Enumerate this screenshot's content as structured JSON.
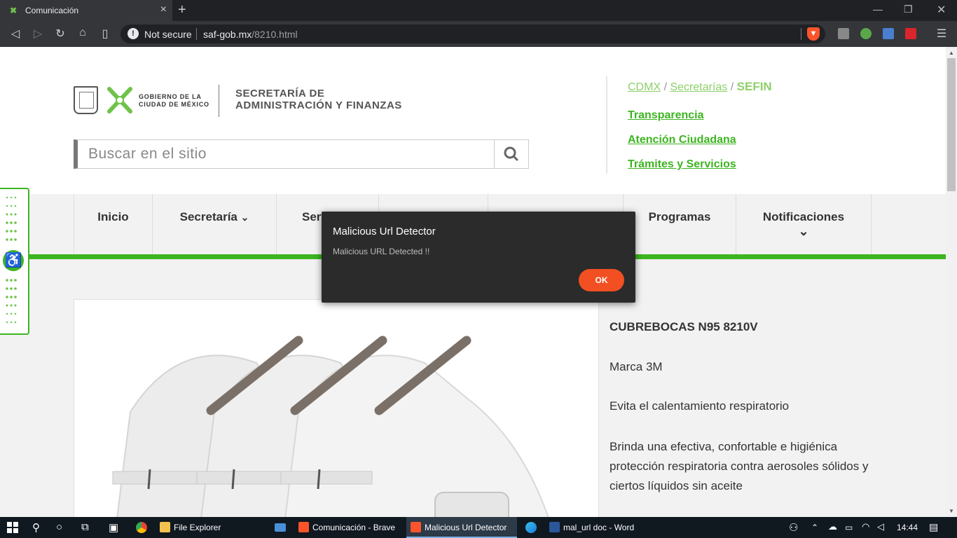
{
  "browser": {
    "tab_title": "Comunicación",
    "not_secure": "Not secure",
    "url_host": "saf-gob.mx",
    "url_path": "/8210.html"
  },
  "header": {
    "gov_line1": "GOBIERNO DE LA",
    "gov_line2": "CIUDAD DE MÉXICO",
    "secretaria_line1": "SECRETARÍA DE",
    "secretaria_line2": "ADMINISTRACIÓN Y FINANZAS",
    "search_placeholder": "Buscar en el sitio"
  },
  "breadcrumb": {
    "cdmx": "CDMX",
    "sep1": "/",
    "secretarias": "Secretarías",
    "sep2": "/",
    "current": "SEFIN"
  },
  "side_links": {
    "transparencia": "Transparencia",
    "atencion": "Atención Ciudadana",
    "tramites": "Trámites y Servicios"
  },
  "nav": {
    "inicio": "Inicio",
    "secretaria": "Secretaría",
    "servicios_partial": "Serv",
    "programas": "Programas",
    "notificaciones": "Notificaciones"
  },
  "product": {
    "title": "CUBREBOCAS N95 8210V",
    "brand": "Marca 3M",
    "line1": "Evita el calentamiento respiratorio",
    "desc": "Brinda una efectiva, confortable e higiénica protección respiratoria contra aerosoles sólidos y ciertos líquidos sin aceite"
  },
  "dialog": {
    "title": "Malicious Url Detector",
    "message": "Malicious URL Detected !!",
    "ok": "OK"
  },
  "taskbar": {
    "file_explorer": "File Explorer",
    "brave": "Comunicación - Brave",
    "detector": "Malicious Url Detector",
    "word": "mal_url doc - Word",
    "time": "14:44"
  },
  "colors": {
    "brand_green": "#3cb520",
    "dialog_ok": "#f25022",
    "dialog_bg": "#2b2b2b"
  }
}
